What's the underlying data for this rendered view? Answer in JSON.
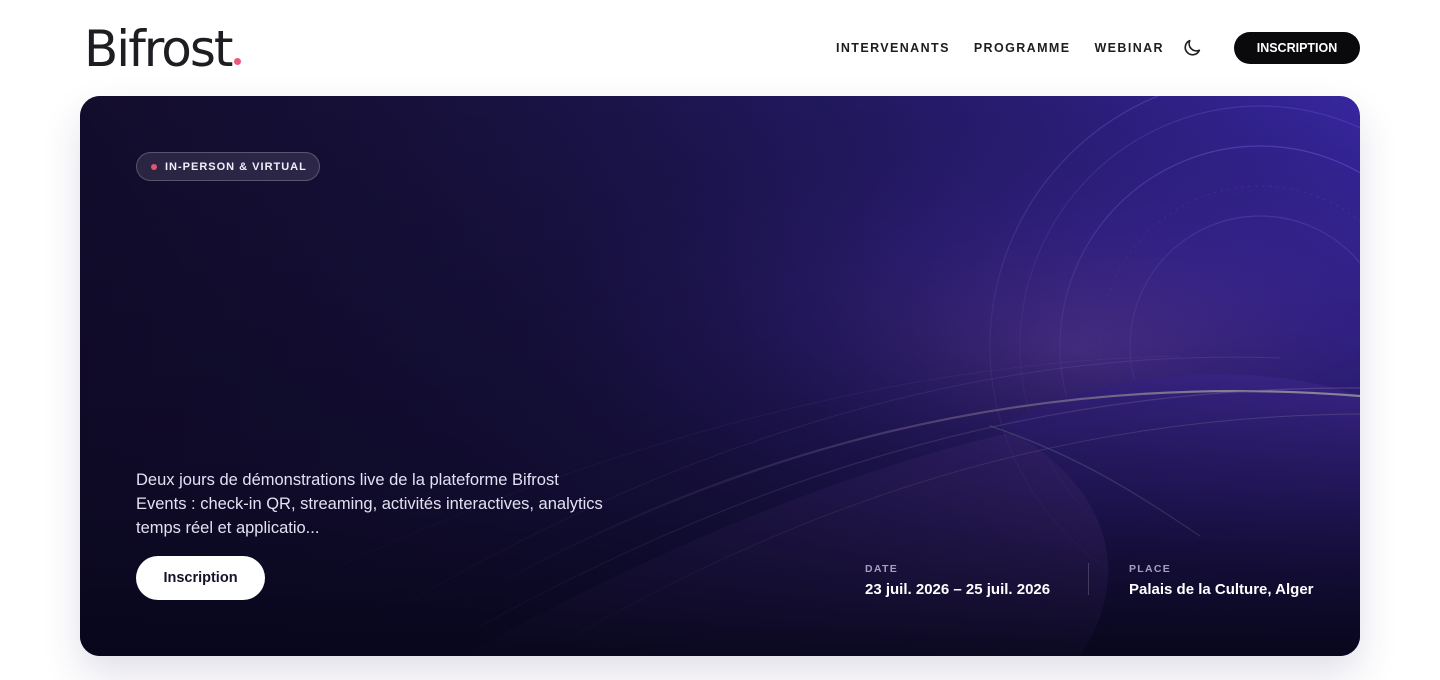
{
  "header": {
    "logo_text": "Bifrost",
    "nav": [
      "INTERVENANTS",
      "PROGRAMME",
      "WEBINAR"
    ],
    "theme_toggle_icon": "moon-icon",
    "signup_label": "INSCRIPTION"
  },
  "hero": {
    "badge_label": "IN-PERSON & VIRTUAL",
    "description": "Deux jours de démonstrations live de la plateforme Bifrost Events : check-in QR, streaming, activités interactives, analytics temps réel et applicatio...",
    "cta_label": "Inscription",
    "date_label": "DATE",
    "date_value": "23 juil. 2026 – 25 juil. 2026",
    "place_label": "PLACE",
    "place_value": "Palais de la Culture, Alger"
  },
  "colors": {
    "logo_dot": "#e85a7c",
    "badge_dot": "#e0556f",
    "signup_bg": "#0a0a0c",
    "signup_text": "#ffffff"
  }
}
